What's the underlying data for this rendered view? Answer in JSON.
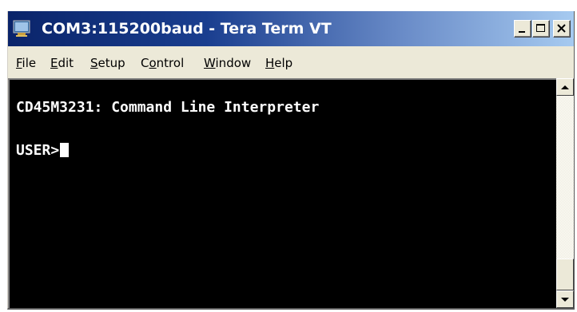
{
  "window": {
    "title": "COM3:115200baud - Tera Term VT"
  },
  "menu": {
    "items": [
      {
        "accel": "F",
        "rest": "ile"
      },
      {
        "accel": "E",
        "rest": "dit"
      },
      {
        "accel": "S",
        "rest": "etup"
      },
      {
        "pre": "C",
        "accel": "o",
        "rest": "ntrol"
      },
      {
        "accel": "W",
        "rest": "indow"
      },
      {
        "accel": "H",
        "rest": "elp"
      }
    ]
  },
  "terminal": {
    "lines": [
      "CD45M3231: Command Line Interpreter",
      "USER>"
    ]
  },
  "colors": {
    "terminal_bg": "#000000",
    "terminal_fg": "#ffffff",
    "titlebar_start": "#0a246a",
    "titlebar_end": "#a6caf0"
  }
}
